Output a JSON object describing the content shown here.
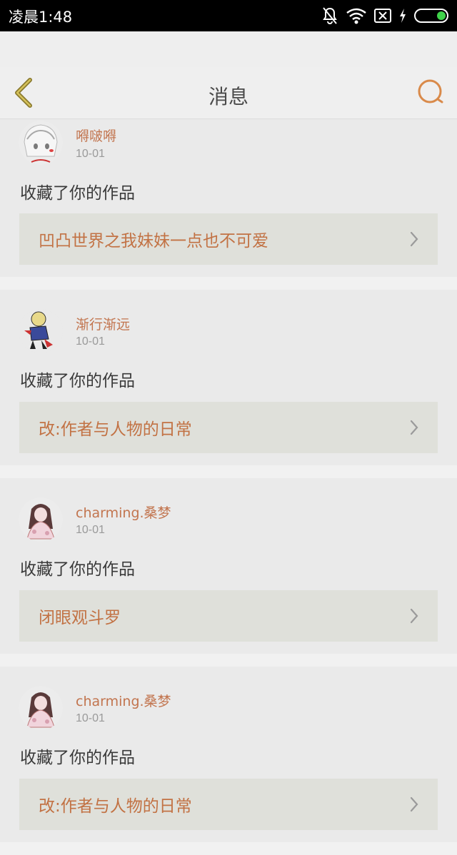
{
  "status_bar": {
    "time": "凌晨1:48"
  },
  "header": {
    "title": "消息"
  },
  "messages": [
    {
      "username": "嘚啵嘚",
      "date": "10-01",
      "action": "收藏了你的作品",
      "work": "凹凸世界之我妹妹一点也不可爱"
    },
    {
      "username": "渐行渐远",
      "date": "10-01",
      "action": "收藏了你的作品",
      "work": "改:作者与人物的日常"
    },
    {
      "username": "charming.桑梦",
      "date": "10-01",
      "action": "收藏了你的作品",
      "work": "闭眼观斗罗"
    },
    {
      "username": "charming.桑梦",
      "date": "10-01",
      "action": "收藏了你的作品",
      "work": "改:作者与人物的日常"
    }
  ],
  "colors": {
    "accent": "#c2754f",
    "back_arrow": "#8a7a2e",
    "search": "#d98a4a"
  }
}
